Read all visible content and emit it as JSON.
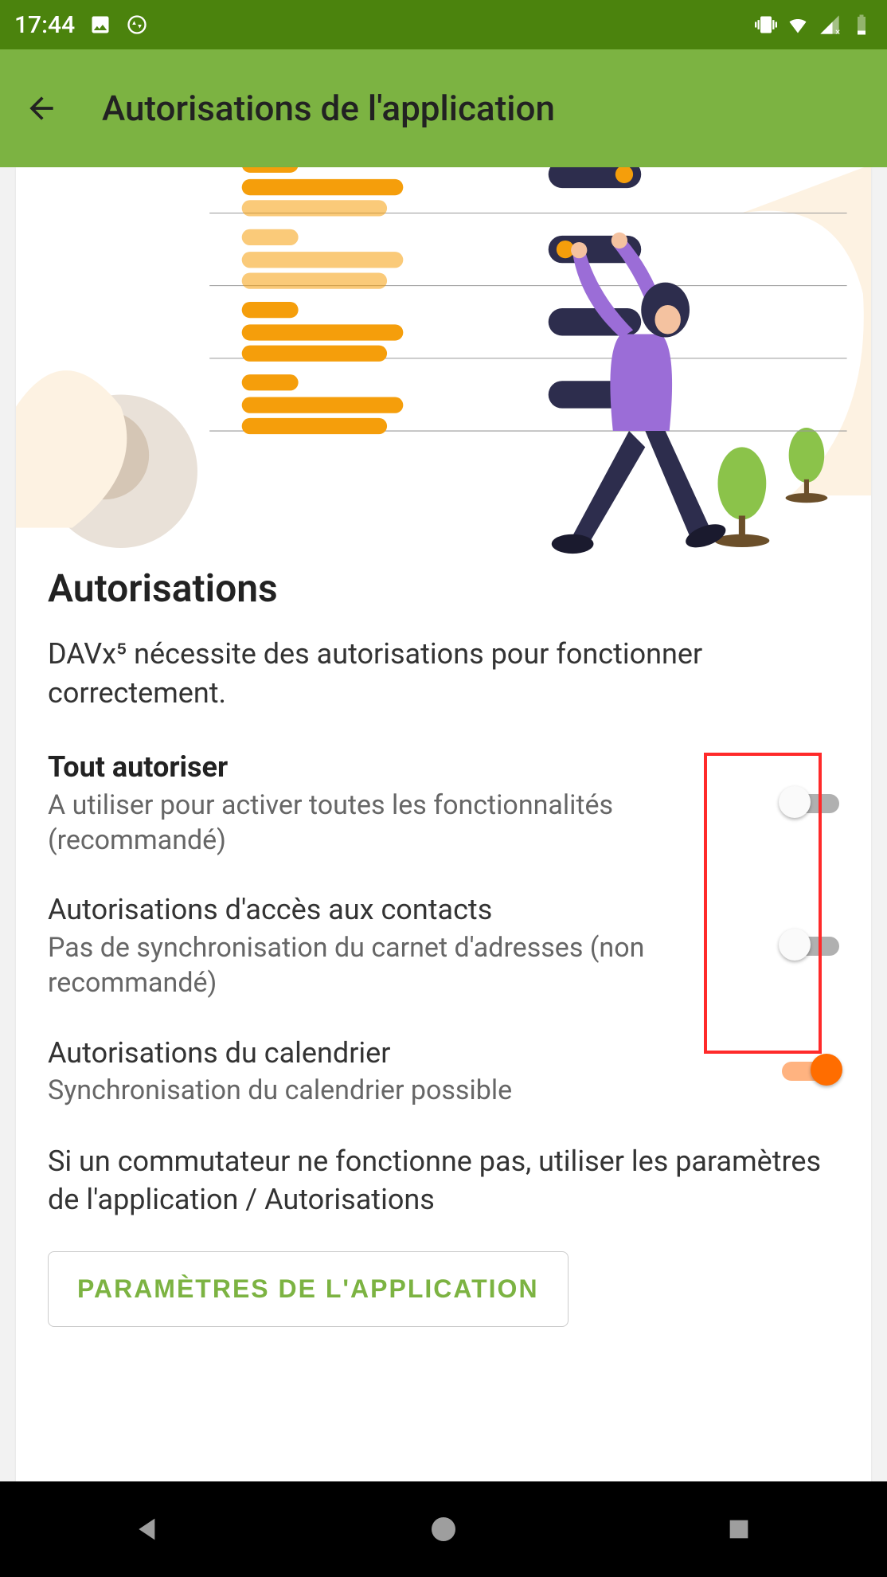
{
  "status": {
    "time": "17:44"
  },
  "appbar": {
    "title": "Autorisations de l'application"
  },
  "section": {
    "title": "Autorisations",
    "desc": "DAVx⁵ nécessite des autorisations pour fonctionner correctement."
  },
  "rows": {
    "allow_all": {
      "title": "Tout autoriser",
      "sub": "A utiliser pour activer toutes les fonctionnalités (recommandé)",
      "on": false
    },
    "contacts": {
      "title": "Autorisations d'accès aux contacts",
      "sub": "Pas de synchronisation du carnet d'adresses (non recommandé)",
      "on": false
    },
    "calendar": {
      "title": "Autorisations du calendrier",
      "sub": "Synchronisation du calendrier possible",
      "on": true
    }
  },
  "hint": "Si un commutateur ne fonctionne pas, utiliser les paramètres de l'application / Autorisations",
  "button": {
    "label": "PARAMÈTRES DE L'APPLICATION"
  },
  "colors": {
    "status_bg": "#4b830d",
    "appbar_bg": "#7cb342",
    "accent_orange": "#ff6d00",
    "highlight_red": "#ff2a2a"
  }
}
